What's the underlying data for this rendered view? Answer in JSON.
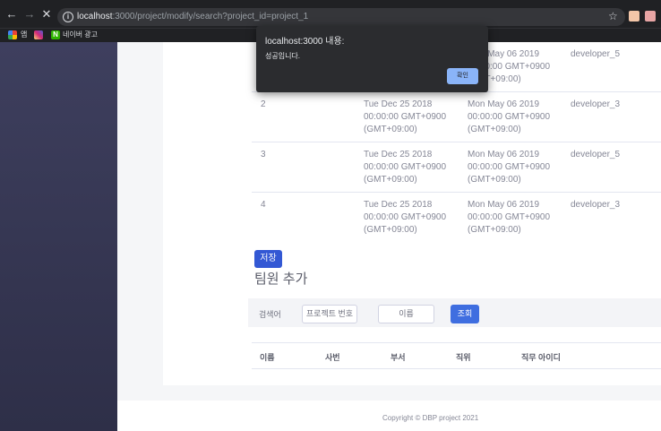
{
  "browser": {
    "url_host": "localhost",
    "url_rest": ":3000/project/modify/search?project_id=project_1",
    "bookmarks": [
      {
        "label": "앱",
        "color": "#e37400"
      },
      {
        "label": "",
        "color": "#c13584"
      },
      {
        "label": "네이버 광고",
        "color": "#2db400",
        "badge": "N"
      }
    ]
  },
  "table": {
    "rows": [
      {
        "no": "",
        "start": "",
        "end": "Mon May 06 2019 00:00:00 GMT+0900 (GMT+09:00)",
        "dev": "developer_5"
      },
      {
        "no": "2",
        "start": "Tue Dec 25 2018 00:00:00 GMT+0900 (GMT+09:00)",
        "end": "Mon May 06 2019 00:00:00 GMT+0900 (GMT+09:00)",
        "dev": "developer_3"
      },
      {
        "no": "3",
        "start": "Tue Dec 25 2018 00:00:00 GMT+0900 (GMT+09:00)",
        "end": "Mon May 06 2019 00:00:00 GMT+0900 (GMT+09:00)",
        "dev": "developer_5"
      },
      {
        "no": "4",
        "start": "Tue Dec 25 2018 00:00:00 GMT+0900 (GMT+09:00)",
        "end": "Mon May 06 2019 00:00:00 GMT+0900 (GMT+09:00)",
        "dev": "developer_3"
      }
    ]
  },
  "save_label": "저장",
  "section_title": "팀원 추가",
  "search": {
    "label": "검색어",
    "project_placeholder": "프로젝트 번호",
    "name_placeholder": "이름",
    "button": "조회"
  },
  "member_headers": [
    "이름",
    "사번",
    "부서",
    "직위",
    "직무 아이디"
  ],
  "footer": "Copyright © DBP project 2021",
  "dialog": {
    "title": "localhost:3000 내용:",
    "message": "성공입니다.",
    "ok": "확인"
  },
  "colors": {
    "sidebar": "#3e3f5e",
    "primary": "#3358d4",
    "dialog_button": "#8ab4f8"
  }
}
